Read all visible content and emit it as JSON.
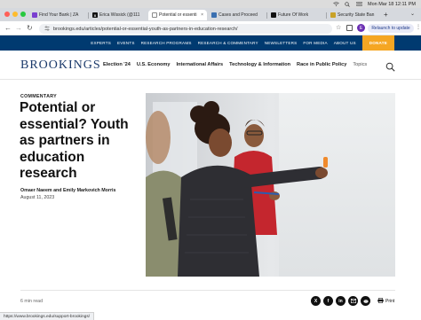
{
  "menubar": {
    "datetime": "Mon Mar 18  12:11 PM"
  },
  "tabs": [
    {
      "title": "Find Your Bank | ZA",
      "favicon_color": "#7a3fd0"
    },
    {
      "title": "Erica Wissick (@111",
      "favicon_color": "#111111"
    },
    {
      "title": "Potential or essenti",
      "favicon_color": "#8a8a8a"
    },
    {
      "title": "Cases and Proceed",
      "favicon_color": "#3a6fb0"
    },
    {
      "title": "Future Of Work",
      "favicon_color": "#111111"
    },
    {
      "title": "Security State Ban",
      "favicon_color": "#c9a227"
    }
  ],
  "toolbar": {
    "url": "brookings.edu/articles/potential-or-essential-youth-as-partners-in-education-research/",
    "relaunch_label": "Relaunch to update",
    "profile_initial": "E"
  },
  "topnav": {
    "items": [
      "EXPERTS",
      "EVENTS",
      "RESEARCH PROGRAMS",
      "RESEARCH & COMMENTARY",
      "NEWSLETTERS",
      "FOR MEDIA",
      "ABOUT US"
    ],
    "donate_label": "DONATE"
  },
  "header": {
    "logo": "BROOKINGS",
    "nav": [
      "Election '24",
      "U.S. Economy",
      "International Affairs",
      "Technology & Information",
      "Race in Public Policy"
    ],
    "topics_label": "Topics"
  },
  "article": {
    "kicker": "COMMENTARY",
    "headline": "Potential or essential? Youth as partners in education research",
    "authors": "Omaer Naeem and Emily Markovich Morris",
    "date": "August 11, 2023",
    "read_time": "6 min read",
    "print_label": "Print"
  },
  "share_icons": [
    "x-icon",
    "facebook-icon",
    "linkedin-icon",
    "email-icon",
    "reddit-icon"
  ],
  "statusbar": {
    "url": "https://www.brookings.edu/support-brookings/"
  }
}
